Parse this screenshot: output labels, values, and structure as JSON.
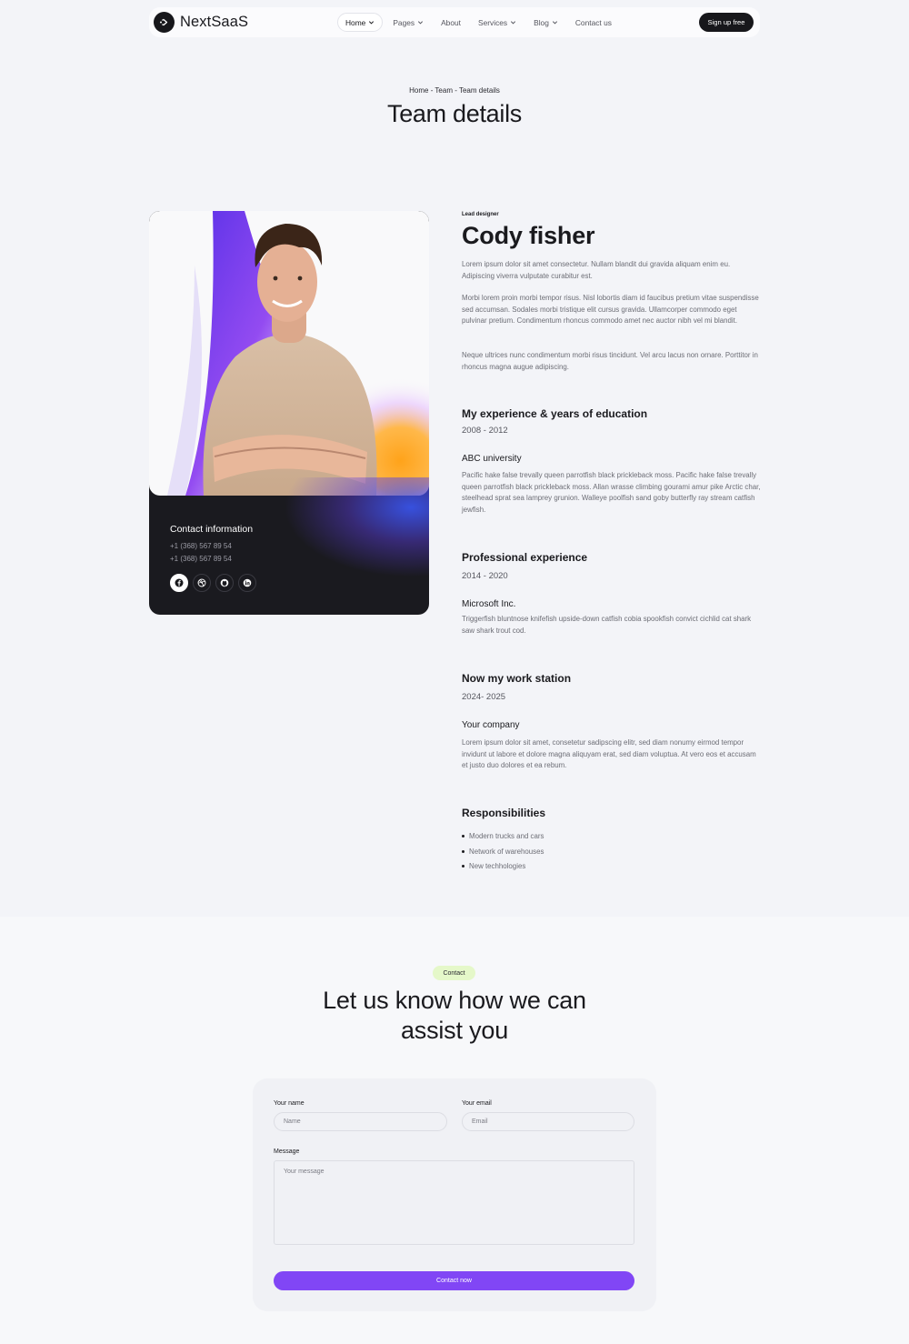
{
  "nav": {
    "brand": "NextSaaS",
    "links": [
      "Home",
      "Pages",
      "About",
      "Services",
      "Blog",
      "Contact us"
    ],
    "signup": "Sign up free"
  },
  "hero": {
    "breadcrumb": "Home - Team - Team details",
    "title": "Team details"
  },
  "profile": {
    "contact_title": "Contact information",
    "phones": [
      "+1 (368) 567 89 54",
      "+1 (368) 567 89 54"
    ],
    "socials": [
      "facebook-icon",
      "dribbble-icon",
      "github-icon",
      "linkedin-icon"
    ]
  },
  "details": {
    "role": "Lead designer",
    "name": "Cody fisher",
    "paragraphs": [
      "Lorem ipsum dolor sit amet consectetur. Nullam blandit dui gravida aliquam enim eu. Adipiscing viverra vulputate curabitur est.",
      "Morbi lorem proin morbi tempor risus. Nisl lobortis diam id faucibus pretium vitae suspendisse sed accumsan. Sodales morbi tristique elit cursus gravida. Ullamcorper commodo eget pulvinar pretium. Condimentum rhoncus commodo amet nec auctor nibh vel mi blandit.",
      "Neque ultrices nunc condimentum morbi risus tincidunt. Vel arcu lacus non ornare. Porttitor in rhoncus magna augue adipiscing."
    ],
    "sections": [
      {
        "title": "My experience & years of education",
        "years": "2008 - 2012",
        "org": "ABC university",
        "text": "Pacific hake false trevally queen parrotfish black prickleback moss. Pacific hake false trevally queen parrotfish black prickleback moss. Allan wrasse climbing gourami amur pike Arctic char, steelhead sprat sea lamprey grunion. Walleye poolfish sand goby butterfly ray stream catfish jewfish."
      },
      {
        "title": "Professional experience",
        "years": "2014 - 2020",
        "org": "Microsoft Inc.",
        "text": "Triggerfish bluntnose knifefish upside-down catfish cobia spookfish convict cichlid cat shark saw shark trout cod."
      },
      {
        "title": "Now my work station",
        "years": "2024- 2025",
        "org": "Your company",
        "text": "Lorem ipsum dolor sit amet, consetetur sadipscing elitr, sed diam nonumy eirmod tempor invidunt ut labore et dolore magna aliquyam erat, sed diam voluptua. At vero eos et accusam et justo duo dolores et ea rebum."
      }
    ],
    "responsibilities_title": "Responsibilities",
    "responsibilities": [
      "Modern trucks and cars",
      "Network of warehouses",
      "New techhologies"
    ]
  },
  "contact": {
    "badge": "Contact",
    "heading_line1": "Let us know how we can",
    "heading_line2": "assist you",
    "name_label": "Your name",
    "name_placeholder": "Name",
    "email_label": "Your email",
    "email_placeholder": "Email",
    "message_label": "Message",
    "message_placeholder": "Your message",
    "submit": "Contact now"
  },
  "colors": {
    "accent": "#8146f5",
    "dark": "#17171b",
    "badge_bg": "#e5f8c9"
  }
}
